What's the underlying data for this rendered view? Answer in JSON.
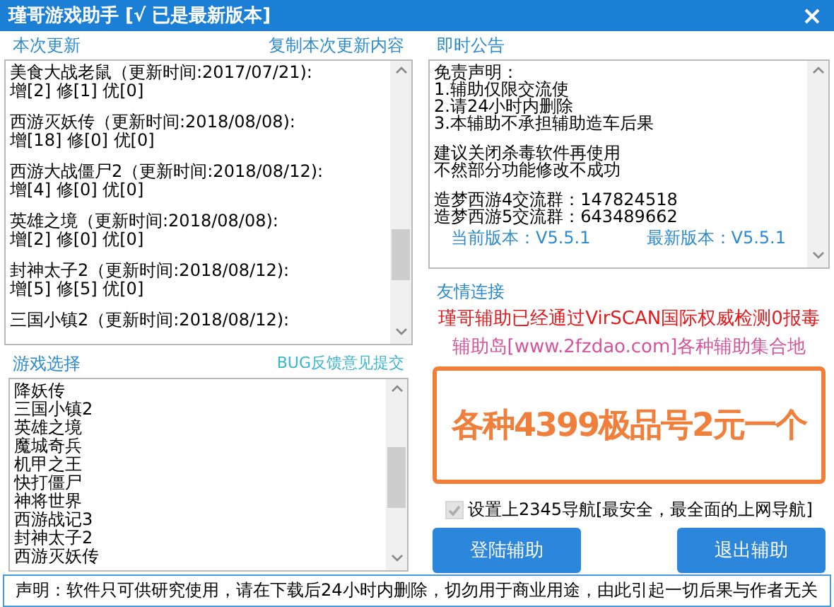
{
  "window": {
    "title": "瑾哥游戏助手 [√ 已是最新版本]"
  },
  "updates": {
    "label": "本次更新",
    "copy_link": "复制本次更新内容",
    "entries": [
      {
        "title": "美食大战老鼠（更新时间:2017/07/21):",
        "stats": "增[2] 修[1] 优[0]"
      },
      {
        "title": "西游灭妖传（更新时间:2018/08/08):",
        "stats": "增[18] 修[0] 优[0]"
      },
      {
        "title": "西游大战僵尸2（更新时间:2018/08/12):",
        "stats": "增[4] 修[0] 优[0]"
      },
      {
        "title": "英雄之境（更新时间:2018/08/08):",
        "stats": "增[2] 修[0] 优[0]"
      },
      {
        "title": "封神太子2（更新时间:2018/08/12):",
        "stats": "增[5] 修[5] 优[0]"
      },
      {
        "title": "三国小镇2（更新时间:2018/08/12):"
      }
    ]
  },
  "game_select": {
    "label": "游戏选择",
    "bug_link": "BUG反馈意见提交",
    "games": [
      "降妖传",
      "三国小镇2",
      "英雄之境",
      "魔城奇兵",
      "机甲之王",
      "快打僵尸",
      "神将世界",
      "西游战记3",
      "封神太子2",
      "西游灭妖传"
    ]
  },
  "notice": {
    "label": "即时公告",
    "paragraphs": [
      [
        "免责声明：",
        "1.辅助仅限交流使",
        "2.请24小时内删除",
        "3.本辅助不承担辅助造车后果"
      ],
      [
        "建议关闭杀毒软件再使用",
        "不然部分功能修改不成功"
      ],
      [
        "造梦西游4交流群：147824518",
        "造梦西游5交流群：643489662"
      ]
    ],
    "current_version": "当前版本：V5.5.1",
    "latest_version": "最新版本：V5.5.1"
  },
  "links": {
    "label": "友情连接",
    "lines": [
      {
        "text": "瑾哥辅助已经通过VirSCAN国际权威检测0报毒",
        "color": "#e3191c"
      },
      {
        "text": "辅助岛[www.2fzdao.com]各种辅助集合地",
        "color": "#d4539b"
      }
    ],
    "banner": "各种4399极品号2元一个"
  },
  "nav_option": {
    "label": "设置上2345导航[最安全，最全面的上网导航]",
    "checked": true,
    "disabled": true
  },
  "buttons": [
    "登陆辅助",
    "退出辅助"
  ],
  "status_bar": "声明：软件只可供研究使用，请在下载后24小时内删除，切勿用于商业用途，由此引起一切后果与作者无关"
}
